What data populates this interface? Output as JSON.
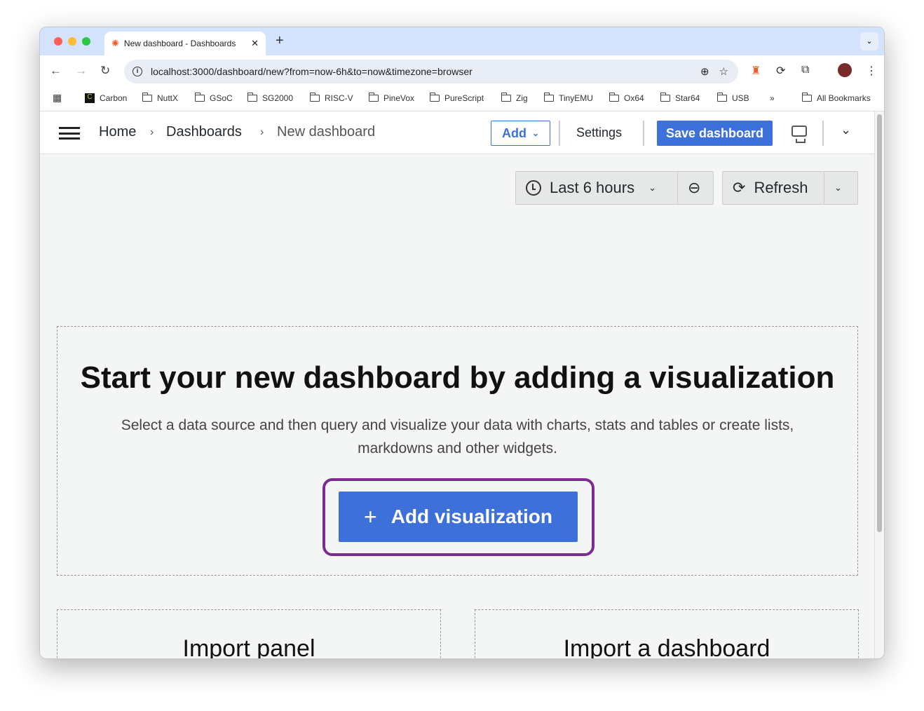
{
  "browser": {
    "tab_title": "New dashboard - Dashboards",
    "url": "localhost:3000/dashboard/new?from=now-6h&to=now&timezone=browser",
    "bookmarks": [
      "Carbon",
      "NuttX",
      "GSoC",
      "SG2000",
      "RISC-V",
      "PineVox",
      "PureScript",
      "Zig",
      "TinyEMU",
      "Ox64",
      "Star64",
      "USB"
    ],
    "overflow": "»",
    "all_bookmarks": "All Bookmarks"
  },
  "header": {
    "breadcrumbs": [
      "Home",
      "Dashboards",
      "New dashboard"
    ],
    "add_label": "Add",
    "settings_label": "Settings",
    "save_label": "Save dashboard"
  },
  "toolbar": {
    "time_range": "Last 6 hours",
    "refresh_label": "Refresh"
  },
  "empty_state": {
    "title": "Start your new dashboard by adding a visualization",
    "description": "Select a data source and then query and visualize your data with charts, stats and tables or create lists, markdowns and other widgets.",
    "button_label": "Add visualization"
  },
  "import_panel": {
    "title": "Import panel"
  },
  "import_dashboard": {
    "title": "Import a dashboard"
  },
  "colors": {
    "primary": "#3d71d9",
    "focus_ring": "#7b2c91",
    "tab_bar": "#d3e3fd"
  }
}
